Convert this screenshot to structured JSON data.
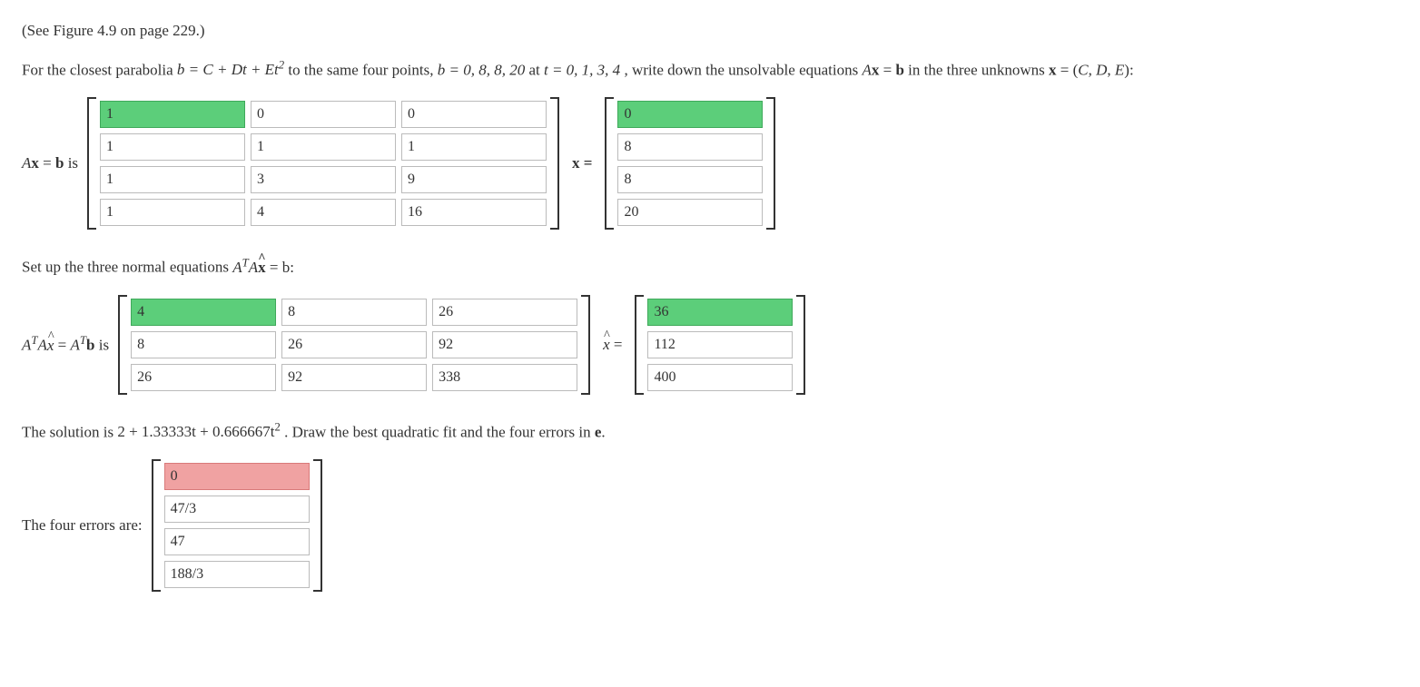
{
  "intro_paren": "(See Figure 4.9 on page 229.)",
  "prompt": {
    "pre": "For the closest parabolia ",
    "eq1": "b = C + Dt + Et",
    "sup1": "2",
    "mid1": " to the same four points, ",
    "eq2": "b = 0, 8, 8, 20",
    "mid2": " at ",
    "eq3": "t = 0, 1, 3, 4",
    "mid3": ", write down the unsolvable equations ",
    "axb": "Ax = b",
    "mid4": " in the three unknowns ",
    "xdef": "x = (C, D, E):"
  },
  "labels": {
    "axb_is": "A",
    "axb_is_2": "x = b",
    "axb_is_3": " is",
    "x_eq": "x =",
    "set_up": "Set up the three normal equations ",
    "atax": "A",
    "atax_T1": "T",
    "atax_A": "A",
    "atax_xhat": "x",
    "atax_eq_b": " = b:",
    "ataxatb_is_1": "A",
    "ataxatb_is_T1": "T",
    "ataxatb_is_2": "A",
    "ataxatb_is_xhat": "x",
    "ataxatb_is_eq": " = A",
    "ataxatb_is_T2": "T",
    "ataxatb_is_b": "b",
    "ataxatb_is_tail": " is",
    "xhat_eq": "x",
    "xhat_eq2": " =",
    "solution_pre": "The solution is ",
    "solution_expr": "2 + 1.33333t + 0.666667t",
    "solution_sup": "2",
    "solution_post": ". Draw the best quadratic fit and the four errors in ",
    "solution_e": "e",
    "solution_dot": ".",
    "errors_label": "The four errors are:"
  },
  "matrix_A": [
    [
      "1",
      "0",
      "0"
    ],
    [
      "1",
      "1",
      "1"
    ],
    [
      "1",
      "3",
      "9"
    ],
    [
      "1",
      "4",
      "16"
    ]
  ],
  "matrix_A_status": [
    [
      "correct",
      "",
      ""
    ],
    [
      "",
      "",
      ""
    ],
    [
      "",
      "",
      ""
    ],
    [
      "",
      "",
      ""
    ]
  ],
  "vec_b": [
    "0",
    "8",
    "8",
    "20"
  ],
  "vec_b_status": [
    "correct",
    "",
    "",
    ""
  ],
  "matrix_ATA": [
    [
      "4",
      "8",
      "26"
    ],
    [
      "8",
      "26",
      "92"
    ],
    [
      "26",
      "92",
      "338"
    ]
  ],
  "matrix_ATA_status": [
    [
      "correct",
      "",
      ""
    ],
    [
      "",
      "",
      ""
    ],
    [
      "",
      "",
      ""
    ]
  ],
  "vec_ATb": [
    "36",
    "112",
    "400"
  ],
  "vec_ATb_status": [
    "correct",
    "",
    ""
  ],
  "vec_errors": [
    "0",
    "47/3",
    "47",
    "188/3"
  ],
  "vec_errors_status": [
    "wrong",
    "",
    "",
    ""
  ]
}
